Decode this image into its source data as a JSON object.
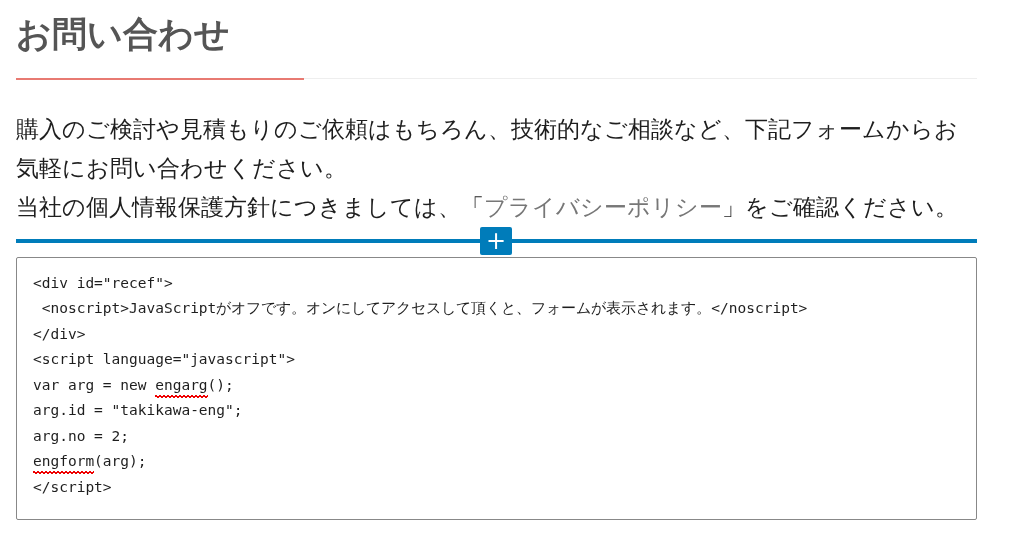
{
  "heading": "お問い合わせ",
  "paragraphs": [
    [
      {
        "text": "購入のご検討や見積もりのご依頼はもちろん、技術的なご相談など、下記フォームからお気軽にお問い合わせください。",
        "kind": "plain"
      }
    ],
    [
      {
        "text": "当社の個人情報保護方針につきましては、「",
        "kind": "plain"
      },
      {
        "text": "プライバシーポリシー",
        "kind": "link"
      },
      {
        "text": "」をご確認ください。",
        "kind": "plain"
      }
    ]
  ],
  "inserter": {
    "symbol": "+"
  },
  "code_lines": [
    [
      {
        "text": "<div id=\"recef\">",
        "misspelled": false
      }
    ],
    [
      {
        "text": " <noscript>JavaScriptがオフです。オンにしてアクセスして頂くと、フォームが表示されます。</noscript>",
        "misspelled": false
      }
    ],
    [
      {
        "text": "</div>",
        "misspelled": false
      }
    ],
    [
      {
        "text": "<script language=\"javascript\">",
        "misspelled": false
      }
    ],
    [
      {
        "text": "var arg = new ",
        "misspelled": false
      },
      {
        "text": "engarg",
        "misspelled": true
      },
      {
        "text": "();",
        "misspelled": false
      }
    ],
    [
      {
        "text": "arg.id = \"takikawa-eng\";",
        "misspelled": false
      }
    ],
    [
      {
        "text": "arg.no = 2;",
        "misspelled": false
      }
    ],
    [
      {
        "text": "engform",
        "misspelled": true
      },
      {
        "text": "(arg);",
        "misspelled": false
      }
    ],
    [
      {
        "text": "</script>",
        "misspelled": false
      }
    ]
  ]
}
